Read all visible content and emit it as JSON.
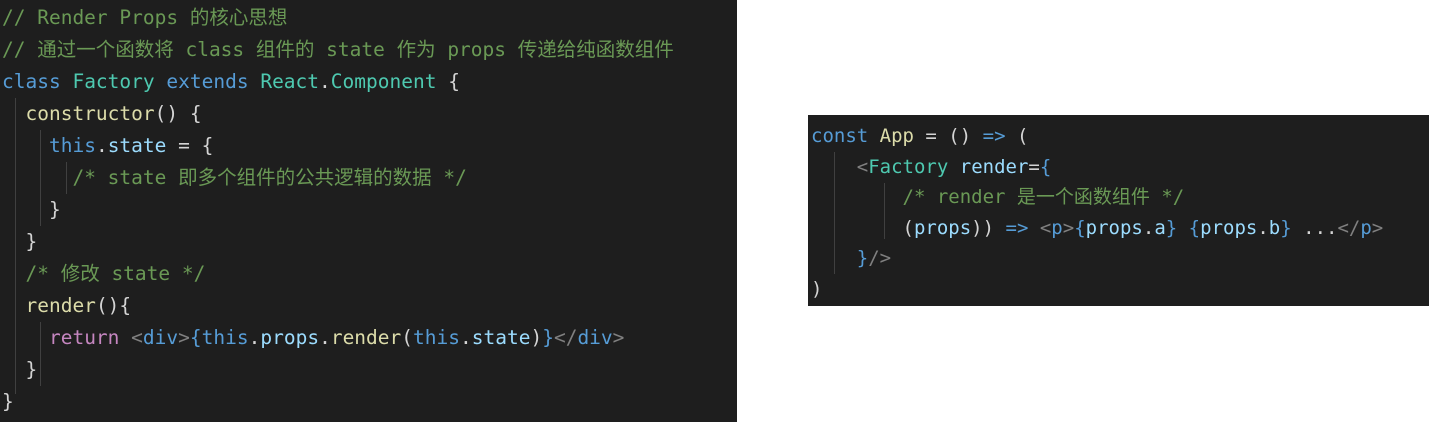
{
  "colors": {
    "editor_bg": "#1e1e1e",
    "comment": "#6a9955",
    "keyword": "#569cd6",
    "control": "#c586c0",
    "class_name": "#4ec9b0",
    "function": "#dcdcaa",
    "variable": "#9cdcfe",
    "punctuation": "#d4d4d4",
    "jsx_tag": "#808080"
  },
  "left_code": [
    [
      {
        "t": "// Render Props 的核心思想",
        "c": "comment"
      }
    ],
    [
      {
        "t": "// 通过一个函数将 class 组件的 state 作为 props 传递给纯函数组件",
        "c": "comment"
      }
    ],
    [
      {
        "t": "class",
        "c": "kw"
      },
      {
        "t": " ",
        "c": "punc"
      },
      {
        "t": "Factory",
        "c": "class"
      },
      {
        "t": " ",
        "c": "punc"
      },
      {
        "t": "extends",
        "c": "kw"
      },
      {
        "t": " ",
        "c": "punc"
      },
      {
        "t": "React",
        "c": "class"
      },
      {
        "t": ".",
        "c": "punc"
      },
      {
        "t": "Component",
        "c": "class"
      },
      {
        "t": " {",
        "c": "punc"
      }
    ],
    [
      {
        "t": "  ",
        "c": "punc"
      },
      {
        "t": "constructor",
        "c": "fn"
      },
      {
        "t": "() {",
        "c": "punc"
      }
    ],
    [
      {
        "t": "    ",
        "c": "punc"
      },
      {
        "t": "this",
        "c": "kw"
      },
      {
        "t": ".",
        "c": "punc"
      },
      {
        "t": "state",
        "c": "var"
      },
      {
        "t": " = {",
        "c": "punc"
      }
    ],
    [
      {
        "t": "      ",
        "c": "punc"
      },
      {
        "t": "/* state 即多个组件的公共逻辑的数据 */",
        "c": "comment"
      }
    ],
    [
      {
        "t": "    }",
        "c": "punc"
      }
    ],
    [
      {
        "t": "  }",
        "c": "punc"
      }
    ],
    [
      {
        "t": "  ",
        "c": "punc"
      },
      {
        "t": "/* 修改 state */",
        "c": "comment"
      }
    ],
    [
      {
        "t": "  ",
        "c": "punc"
      },
      {
        "t": "render",
        "c": "fn"
      },
      {
        "t": "(){",
        "c": "punc"
      }
    ],
    [
      {
        "t": "    ",
        "c": "punc"
      },
      {
        "t": "return",
        "c": "ctrl"
      },
      {
        "t": " ",
        "c": "punc"
      },
      {
        "t": "<",
        "c": "tag"
      },
      {
        "t": "div",
        "c": "kw"
      },
      {
        "t": ">",
        "c": "tag"
      },
      {
        "t": "{",
        "c": "kw"
      },
      {
        "t": "this",
        "c": "kw"
      },
      {
        "t": ".",
        "c": "punc"
      },
      {
        "t": "props",
        "c": "var"
      },
      {
        "t": ".",
        "c": "punc"
      },
      {
        "t": "render",
        "c": "fn"
      },
      {
        "t": "(",
        "c": "punc"
      },
      {
        "t": "this",
        "c": "kw"
      },
      {
        "t": ".",
        "c": "punc"
      },
      {
        "t": "state",
        "c": "var"
      },
      {
        "t": ")",
        "c": "punc"
      },
      {
        "t": "}",
        "c": "kw"
      },
      {
        "t": "</",
        "c": "tag"
      },
      {
        "t": "div",
        "c": "kw"
      },
      {
        "t": ">",
        "c": "tag"
      }
    ],
    [
      {
        "t": "  }",
        "c": "punc"
      }
    ],
    [
      {
        "t": "}",
        "c": "punc"
      }
    ]
  ],
  "right_code": [
    [
      {
        "t": "const",
        "c": "kw"
      },
      {
        "t": " ",
        "c": "punc"
      },
      {
        "t": "App",
        "c": "fn"
      },
      {
        "t": " = () ",
        "c": "punc"
      },
      {
        "t": "=>",
        "c": "kw"
      },
      {
        "t": " (",
        "c": "punc"
      }
    ],
    [
      {
        "t": "    ",
        "c": "punc"
      },
      {
        "t": "<",
        "c": "tag"
      },
      {
        "t": "Factory",
        "c": "class"
      },
      {
        "t": " ",
        "c": "punc"
      },
      {
        "t": "render",
        "c": "var"
      },
      {
        "t": "=",
        "c": "punc"
      },
      {
        "t": "{",
        "c": "kw"
      }
    ],
    [
      {
        "t": "        ",
        "c": "punc"
      },
      {
        "t": "/* render 是一个函数组件 */",
        "c": "comment"
      }
    ],
    [
      {
        "t": "        ",
        "c": "punc"
      },
      {
        "t": "(",
        "c": "punc"
      },
      {
        "t": "props",
        "c": "var"
      },
      {
        "t": ")) ",
        "c": "punc"
      },
      {
        "t": "=>",
        "c": "kw"
      },
      {
        "t": " ",
        "c": "punc"
      },
      {
        "t": "<",
        "c": "tag"
      },
      {
        "t": "p",
        "c": "kw"
      },
      {
        "t": ">",
        "c": "tag"
      },
      {
        "t": "{",
        "c": "kw"
      },
      {
        "t": "props",
        "c": "var"
      },
      {
        "t": ".",
        "c": "punc"
      },
      {
        "t": "a",
        "c": "var"
      },
      {
        "t": "}",
        "c": "kw"
      },
      {
        "t": " ",
        "c": "punc"
      },
      {
        "t": "{",
        "c": "kw"
      },
      {
        "t": "props",
        "c": "var"
      },
      {
        "t": ".",
        "c": "punc"
      },
      {
        "t": "b",
        "c": "var"
      },
      {
        "t": "}",
        "c": "kw"
      },
      {
        "t": " ...",
        "c": "punc"
      },
      {
        "t": "</",
        "c": "tag"
      },
      {
        "t": "p",
        "c": "kw"
      },
      {
        "t": ">",
        "c": "tag"
      }
    ],
    [
      {
        "t": "    ",
        "c": "punc"
      },
      {
        "t": "}",
        "c": "kw"
      },
      {
        "t": "/>",
        "c": "tag"
      }
    ],
    [
      {
        "t": ")",
        "c": "punc"
      }
    ]
  ]
}
